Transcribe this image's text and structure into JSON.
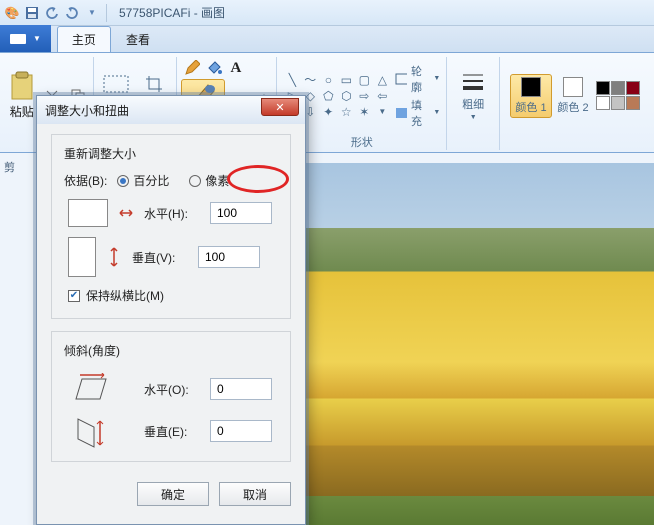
{
  "window": {
    "title": "57758PICAFi - 画图"
  },
  "tabs": {
    "file_icon": "file-menu",
    "home": "主页",
    "view": "查看"
  },
  "ribbon": {
    "clipboard": {
      "paste_label": "粘贴",
      "group_label": "剪"
    },
    "shapes": {
      "outline": "轮廓",
      "fill": "填充",
      "group_label": "形状"
    },
    "size": {
      "stroke_label": "粗细"
    },
    "colors": {
      "color1": "颜色 1",
      "color2": "颜色 2",
      "c1": "#000000",
      "c2": "#ffffff",
      "palette": [
        "#000000",
        "#7f7f7f",
        "#c3c3c3",
        "#880015",
        "#ffffff",
        "#b97a57",
        "#c8bfe7"
      ]
    }
  },
  "dialog": {
    "title": "调整大小和扭曲",
    "resize_legend": "重新调整大小",
    "by_label": "依据(B):",
    "percent": "百分比",
    "pixel": "像素",
    "horizontal_h": "水平(H):",
    "vertical_v": "垂直(V):",
    "h_val": "100",
    "v_val": "100",
    "aspect": "保持纵横比(M)",
    "skew_legend": "倾斜(角度)",
    "horizontal_o": "水平(O):",
    "vertical_e": "垂直(E):",
    "ho_val": "0",
    "ve_val": "0",
    "ok": "确定",
    "cancel": "取消"
  }
}
